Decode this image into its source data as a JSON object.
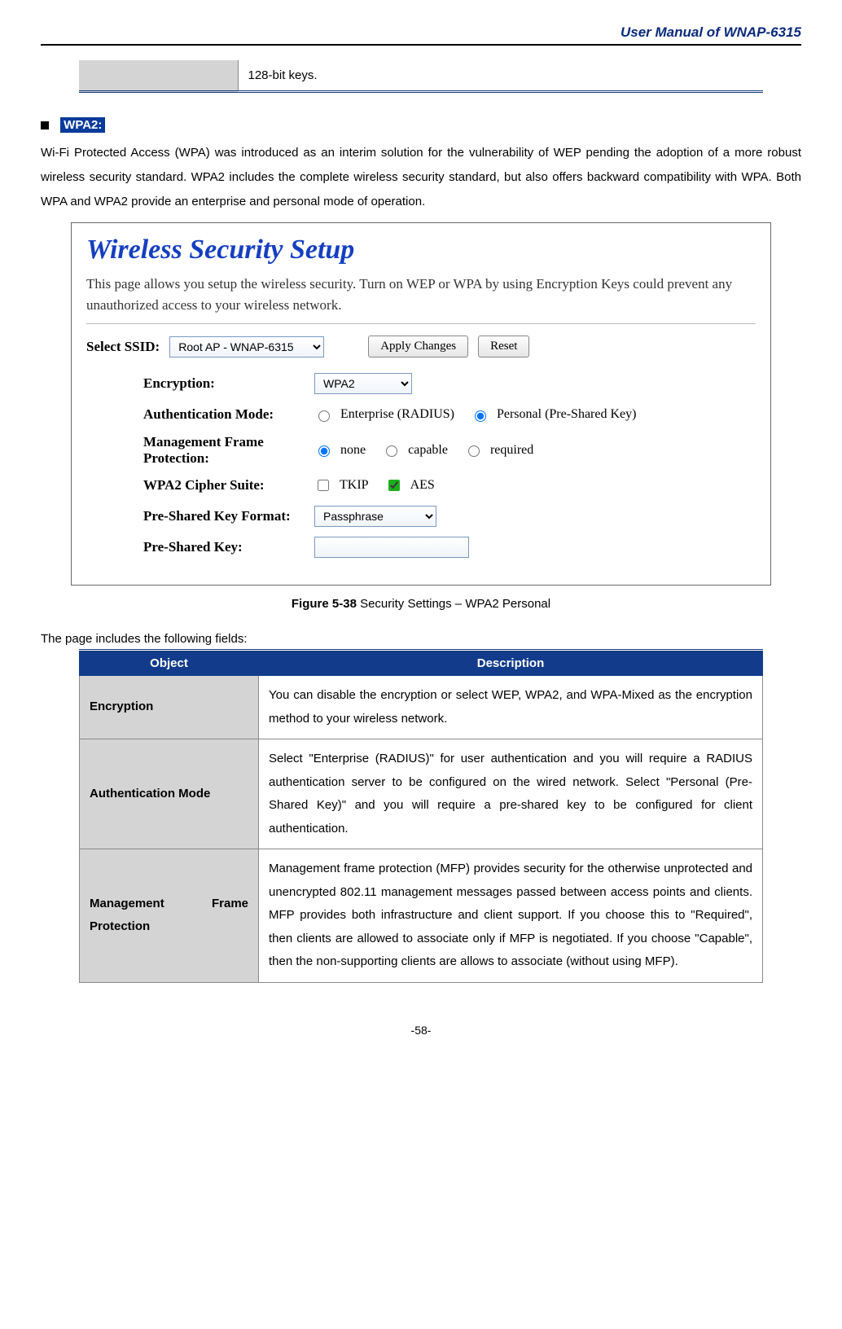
{
  "header": {
    "title": "User Manual of WNAP-6315"
  },
  "top_table": {
    "right_text": "128-bit keys."
  },
  "wpa2": {
    "badge": "WPA2:",
    "paragraph": "Wi-Fi Protected Access (WPA) was introduced as an interim solution for the vulnerability of WEP pending the adoption of a more robust wireless security standard. WPA2 includes the complete wireless security standard, but also offers backward compatibility with WPA. Both WPA and WPA2 provide an enterprise and personal mode of operation."
  },
  "figure": {
    "title": "Wireless Security Setup",
    "intro": "This page allows you setup the wireless security. Turn on WEP or WPA by using Encryption Keys could prevent any unauthorized access to your wireless network.",
    "ssid_label": "Select SSID:",
    "ssid_value": "Root AP - WNAP-6315",
    "apply_btn": "Apply Changes",
    "reset_btn": "Reset",
    "rows": {
      "encryption": {
        "label": "Encryption:",
        "value": "WPA2"
      },
      "auth": {
        "label": "Authentication Mode:",
        "opt1": "Enterprise (RADIUS)",
        "opt2": "Personal (Pre-Shared Key)"
      },
      "mfp": {
        "label": "Management Frame Protection:",
        "opt1": "none",
        "opt2": "capable",
        "opt3": "required"
      },
      "cipher": {
        "label": "WPA2 Cipher Suite:",
        "opt1": "TKIP",
        "opt2": "AES"
      },
      "pskfmt": {
        "label": "Pre-Shared Key Format:",
        "value": "Passphrase"
      },
      "psk": {
        "label": "Pre-Shared Key:",
        "value": ""
      }
    },
    "caption_bold": "Figure 5-38",
    "caption_rest": " Security Settings – WPA2 Personal"
  },
  "fields_intro": "The page includes the following fields:",
  "desc_table": {
    "head_object": "Object",
    "head_desc": "Description",
    "rows": [
      {
        "object": "Encryption",
        "desc": "You can disable the encryption or select WEP, WPA2, and WPA-Mixed as the encryption method to your wireless network."
      },
      {
        "object": "Authentication Mode",
        "desc": "Select \"Enterprise (RADIUS)\" for user authentication and you will require a RADIUS authentication server to be configured on the wired network. Select \"Personal (Pre-Shared Key)\" and you will require a pre-shared key to be configured for client authentication."
      },
      {
        "object": "Management Frame Protection",
        "desc": "Management frame protection (MFP) provides security for the otherwise unprotected and unencrypted 802.11 management messages passed between access points and clients. MFP provides both infrastructure and client support. If you choose this to \"Required\", then clients are allowed to associate only if MFP is negotiated. If you choose \"Capable\", then the non-supporting clients are allows to associate (without using MFP)."
      }
    ]
  },
  "footer": "-58-"
}
